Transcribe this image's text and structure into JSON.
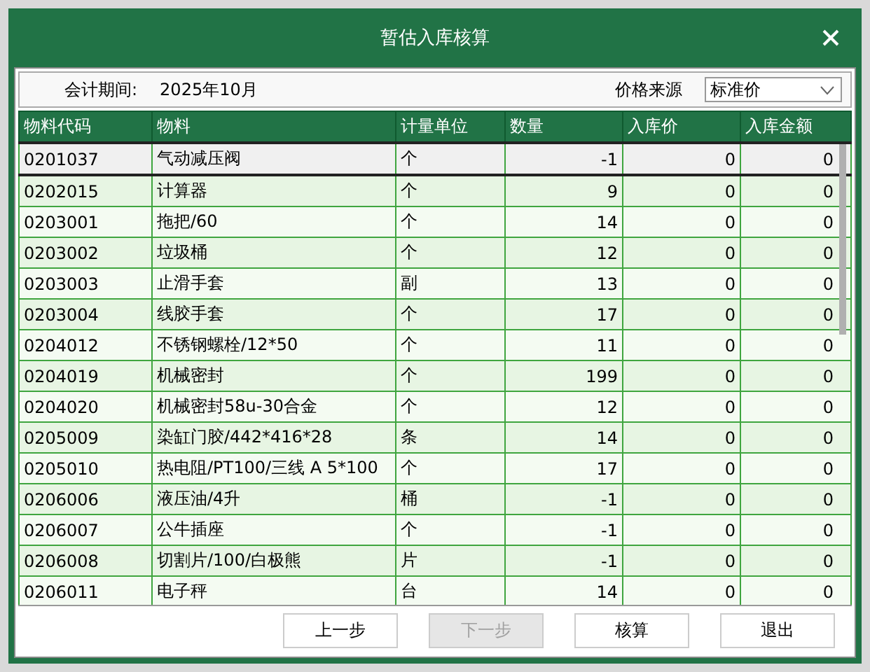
{
  "dialog": {
    "title": "暂估入库核算"
  },
  "filter": {
    "period_label": "会计期间:",
    "period_value": "2025年10月",
    "price_source_label": "价格来源",
    "price_source_value": "标准价"
  },
  "table": {
    "columns": [
      "物料代码",
      "物料",
      "计量单位",
      "数量",
      "入库价",
      "入库金额"
    ],
    "rows": [
      {
        "cells": [
          "0201037",
          "气动减压阀",
          "个",
          "-1",
          "0",
          "0"
        ],
        "selected": true
      },
      {
        "cells": [
          "0202015",
          "计算器",
          "个",
          "9",
          "0",
          "0"
        ],
        "selected": false
      },
      {
        "cells": [
          "0203001",
          "拖把/60",
          "个",
          "14",
          "0",
          "0"
        ],
        "selected": false
      },
      {
        "cells": [
          "0203002",
          "垃圾桶",
          "个",
          "12",
          "0",
          "0"
        ],
        "selected": false
      },
      {
        "cells": [
          "0203003",
          "止滑手套",
          "副",
          "13",
          "0",
          "0"
        ],
        "selected": false
      },
      {
        "cells": [
          "0203004",
          "线胶手套",
          "个",
          "17",
          "0",
          "0"
        ],
        "selected": false
      },
      {
        "cells": [
          "0204012",
          "不锈钢螺栓/12*50",
          "个",
          "11",
          "0",
          "0"
        ],
        "selected": false
      },
      {
        "cells": [
          "0204019",
          "机械密封",
          "个",
          "199",
          "0",
          "0"
        ],
        "selected": false
      },
      {
        "cells": [
          "0204020",
          "机械密封58u-30合金",
          "个",
          "12",
          "0",
          "0"
        ],
        "selected": false
      },
      {
        "cells": [
          "0205009",
          "染缸门胶/442*416*28",
          "条",
          "14",
          "0",
          "0"
        ],
        "selected": false
      },
      {
        "cells": [
          "0205010",
          "热电阻/PT100/三线 A 5*100",
          "个",
          "17",
          "0",
          "0"
        ],
        "selected": false
      },
      {
        "cells": [
          "0206006",
          "液压油/4升",
          "桶",
          "-1",
          "0",
          "0"
        ],
        "selected": false
      },
      {
        "cells": [
          "0206007",
          "公牛插座",
          "个",
          "-1",
          "0",
          "0"
        ],
        "selected": false
      },
      {
        "cells": [
          "0206008",
          "切割片/100/白极熊",
          "片",
          "-1",
          "0",
          "0"
        ],
        "selected": false
      },
      {
        "cells": [
          "0206011",
          "电子秤",
          "台",
          "14",
          "0",
          "0"
        ],
        "selected": false
      }
    ]
  },
  "buttons": [
    {
      "label": "上一步",
      "disabled": false
    },
    {
      "label": "下一步",
      "disabled": true
    },
    {
      "label": "核算",
      "disabled": false
    },
    {
      "label": "退出",
      "disabled": false
    }
  ]
}
